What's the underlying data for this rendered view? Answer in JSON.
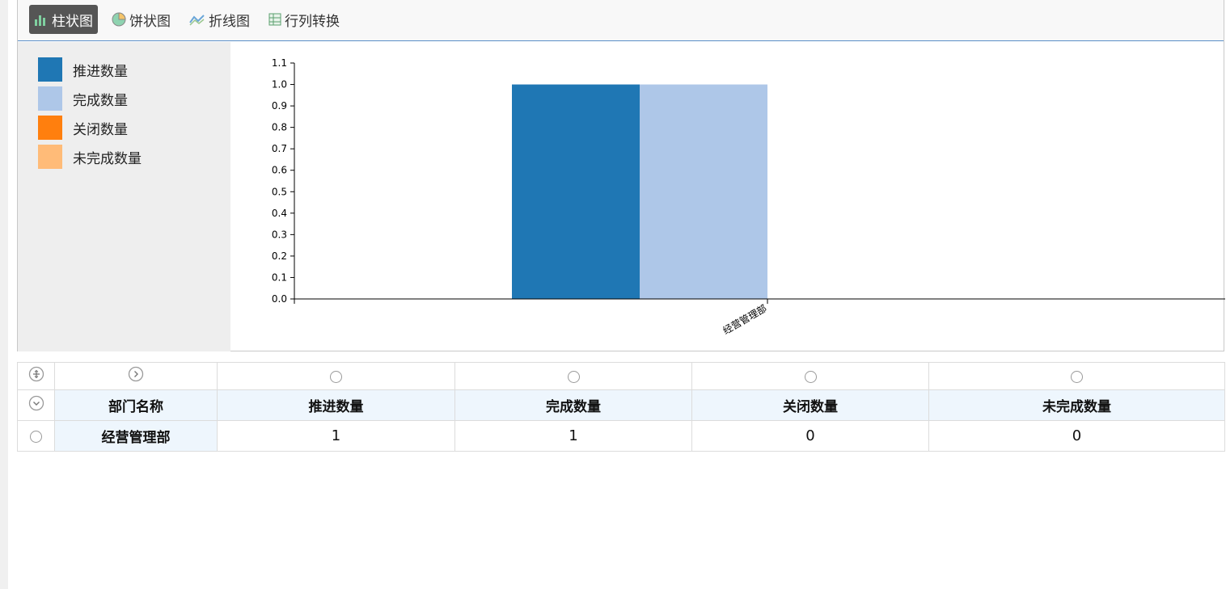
{
  "toolbar": {
    "bar_label": "柱状图",
    "pie_label": "饼状图",
    "line_label": "折线图",
    "transpose_label": "行列转换"
  },
  "legend": [
    {
      "label": "推进数量",
      "color": "#1f77b4"
    },
    {
      "label": "完成数量",
      "color": "#aec7e8"
    },
    {
      "label": "关闭数量",
      "color": "#ff7f0e"
    },
    {
      "label": "未完成数量",
      "color": "#ffbb78"
    }
  ],
  "chart_data": {
    "type": "bar",
    "categories": [
      "经营管理部"
    ],
    "series": [
      {
        "name": "推进数量",
        "values": [
          1
        ]
      },
      {
        "name": "完成数量",
        "values": [
          1
        ]
      },
      {
        "name": "关闭数量",
        "values": [
          0
        ]
      },
      {
        "name": "未完成数量",
        "values": [
          0
        ]
      }
    ],
    "ylim": [
      0,
      1.1
    ],
    "yticks": [
      0.0,
      0.1,
      0.2,
      0.3,
      0.4,
      0.5,
      0.6,
      0.7,
      0.8,
      0.9,
      1.0,
      1.1
    ],
    "legend_position": "left",
    "grid": false
  },
  "table": {
    "headers": [
      "部门名称",
      "推进数量",
      "完成数量",
      "关闭数量",
      "未完成数量"
    ],
    "rows": [
      [
        "经营管理部",
        "1",
        "1",
        "0",
        "0"
      ]
    ]
  }
}
